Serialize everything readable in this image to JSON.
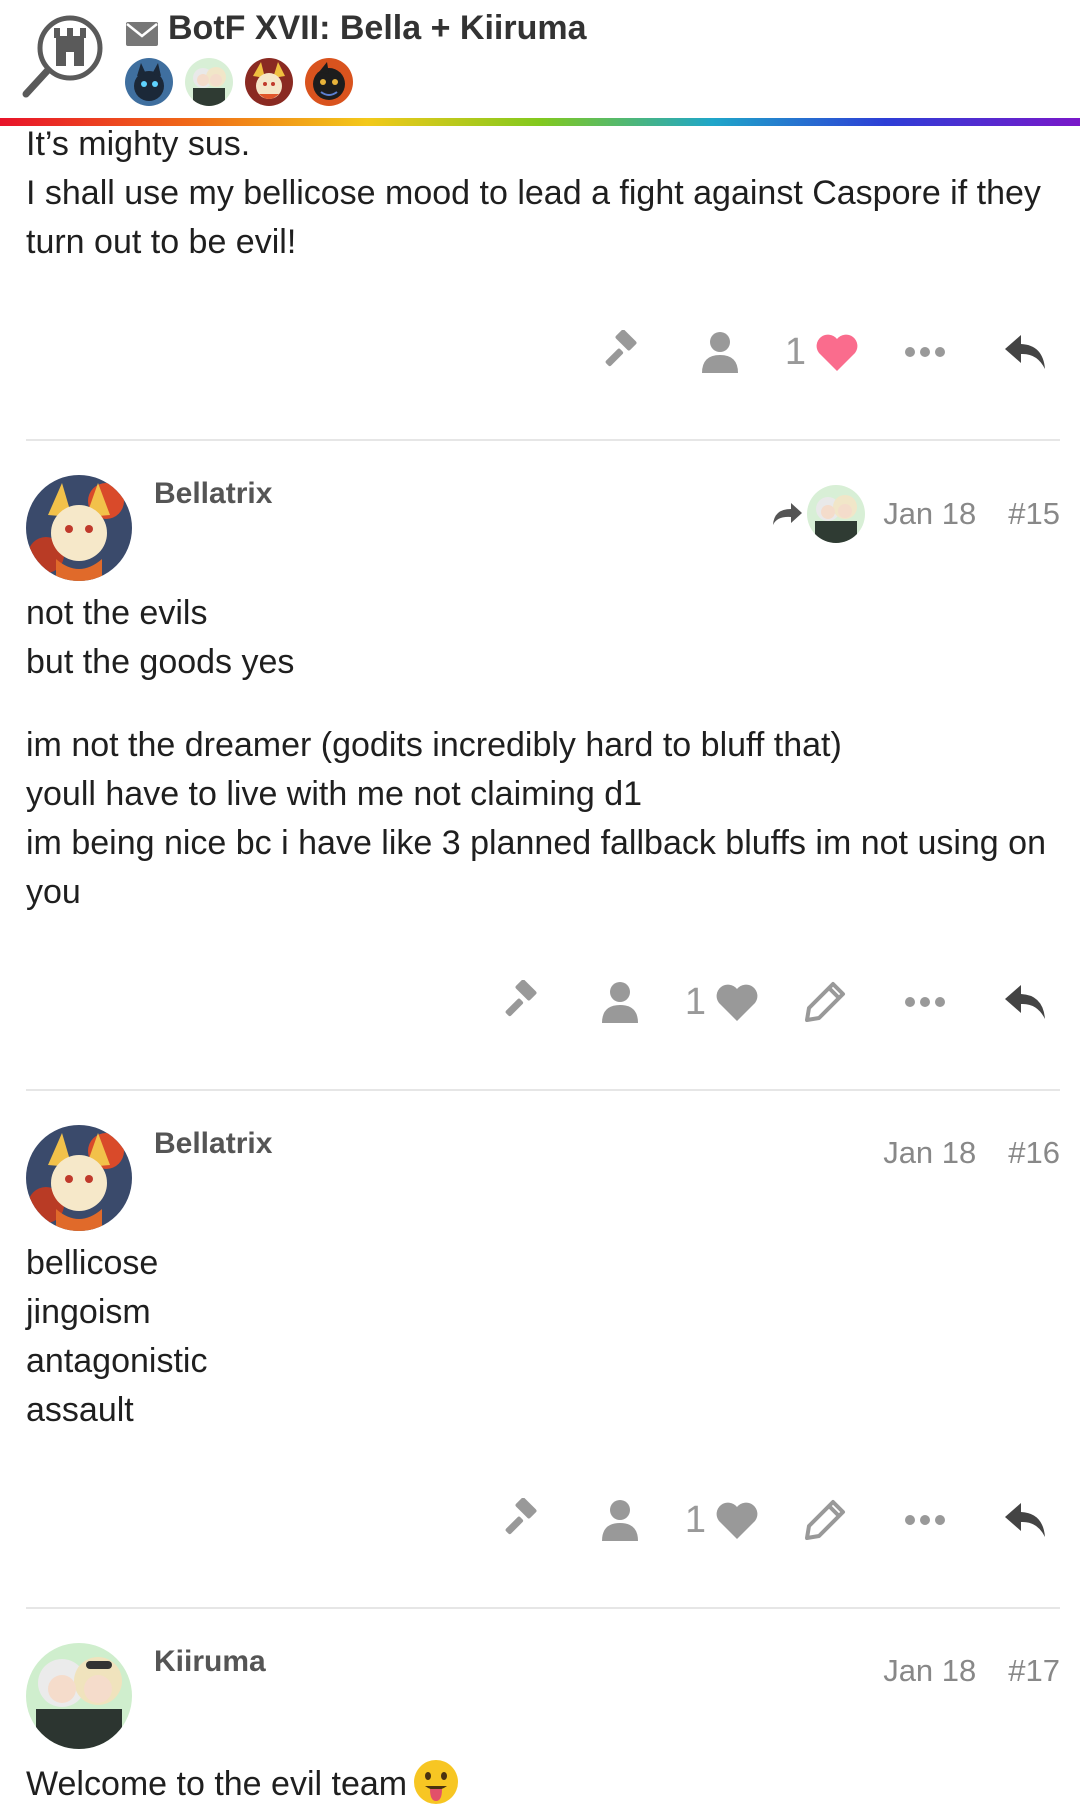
{
  "header": {
    "title": "BotF XVII: Bella + Kiiruma",
    "participants": [
      {
        "name": "participant-1"
      },
      {
        "name": "participant-2"
      },
      {
        "name": "participant-3"
      },
      {
        "name": "participant-4"
      }
    ]
  },
  "posts": [
    {
      "paragraphs": [
        [
          "It’s mighty sus.",
          "I shall use my bellicose mood to lead a fight against Caspore if they turn out to be evil!"
        ]
      ],
      "likes": "1",
      "liked": true
    },
    {
      "username": "Bellatrix",
      "date": "Jan 18",
      "post_number": "#15",
      "has_reply_to": true,
      "paragraphs": [
        [
          "not the evils",
          "but the goods yes"
        ],
        [
          "im not the dreamer (godits incredibly hard to bluff that)",
          "youll have to live with me not claiming d1",
          "im being nice bc i have like 3 planned fallback bluffs im not using on you"
        ]
      ],
      "likes": "1",
      "liked": false
    },
    {
      "username": "Bellatrix",
      "date": "Jan 18",
      "post_number": "#16",
      "paragraphs": [
        [
          "bellicose",
          "jingoism",
          "antagonistic",
          "assault"
        ]
      ],
      "likes": "1",
      "liked": false
    },
    {
      "username": "Kiiruma",
      "date": "Jan 18",
      "post_number": "#17",
      "paragraphs": [
        [
          "Welcome to the evil team"
        ]
      ],
      "emoji": "stuck-out-tongue-emoji"
    }
  ],
  "colors": {
    "liked_heart": "#fa6c8d",
    "icon_gray": "#999999",
    "meta_gray": "#888888"
  }
}
